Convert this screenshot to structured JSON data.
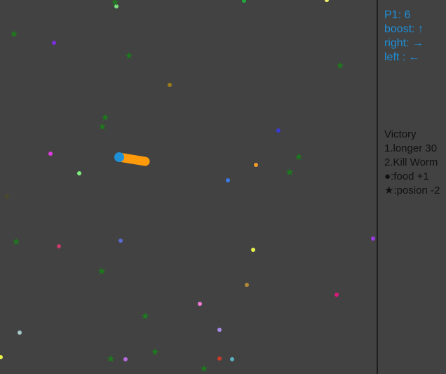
{
  "hud": {
    "score_label": "P1: 6",
    "boost_label": "boost: ↑",
    "right_label": "right: →",
    "left_label": "left  : ←",
    "text_color": "#1e8fd8"
  },
  "rules": {
    "title": "Victory",
    "rule1": "1.longer 30",
    "rule2": "2.Kill Worm",
    "food_rule": "●:food +1",
    "poison_rule": "★:posion -2"
  },
  "colors": {
    "background": "#424242",
    "divider": "#1e1e1e",
    "worm_body": "#ff9a0a",
    "worm_head": "#1f8fd6",
    "poison": "#1d7a1d"
  },
  "worm": {
    "player": "P1",
    "length": 6
  },
  "items": {
    "food_count": 32,
    "poison_count": 16
  }
}
